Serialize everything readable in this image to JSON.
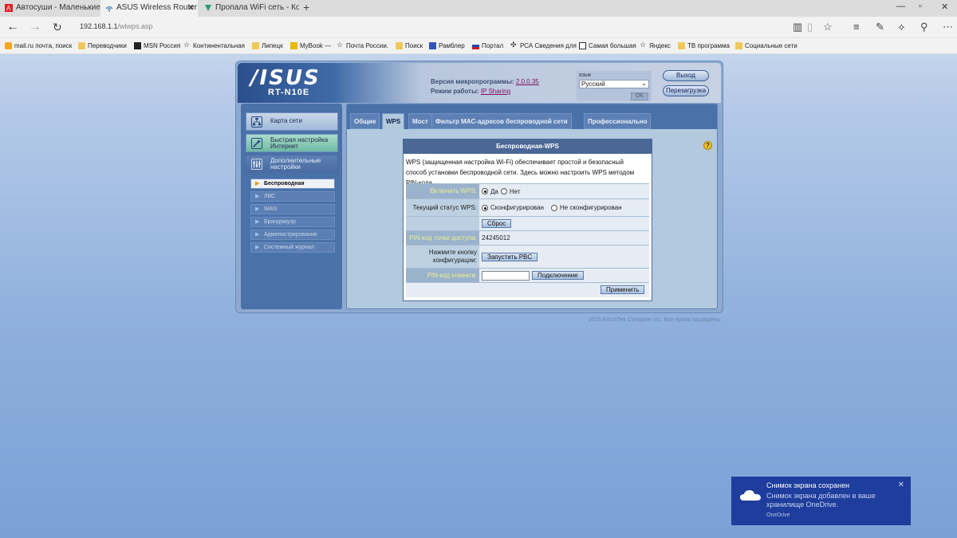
{
  "browser": {
    "tabs": [
      {
        "title": "Автосуши - Маленькие ро",
        "active": false
      },
      {
        "title": "ASUS Wireless Router R",
        "active": true
      },
      {
        "title": "Пропала WiFi сеть - Компь",
        "active": false
      }
    ],
    "url_host": "192.168.1.1",
    "url_path": "/wlwps.asp",
    "favorites": [
      {
        "label": "mail.ru почта, поиск",
        "icon": "mailru-icon"
      },
      {
        "label": "Переводчики",
        "icon": "folder-icon"
      },
      {
        "label": "MSN Россия",
        "icon": "msn-icon"
      },
      {
        "label": "Континентальная",
        "icon": "star-icon"
      },
      {
        "label": "Липецк",
        "icon": "folder-icon"
      },
      {
        "label": "MyBook —",
        "icon": "mybook-icon"
      },
      {
        "label": "Почта России.",
        "icon": "star-icon"
      },
      {
        "label": "Поиск",
        "icon": "folder-icon"
      },
      {
        "label": "Рамблер",
        "icon": "rambler-icon"
      },
      {
        "label": "Портал",
        "icon": "flag-icon"
      },
      {
        "label": "РСА Сведения для",
        "icon": "rsa-icon"
      },
      {
        "label": "Самая большая",
        "icon": "doc-icon"
      },
      {
        "label": "Яндекс",
        "icon": "star-icon"
      },
      {
        "label": "ТВ программа",
        "icon": "folder-icon"
      },
      {
        "label": "Социальные сети",
        "icon": "folder-icon"
      }
    ]
  },
  "router": {
    "logo": "/ISUS",
    "model": "RT-N10E",
    "firmware_label": "Версия микропрограммы:",
    "firmware_value": "2.0.0.35",
    "mode_label": "Режим работы:",
    "mode_value": "IP Sharing",
    "language_label": "язык",
    "language_value": "Русский",
    "ok_label": "OK",
    "logout_label": "Выход",
    "reboot_label": "Перезагрузка",
    "menu": [
      {
        "label": "Карта сети"
      },
      {
        "label": "Быстрая настройка Интернет"
      },
      {
        "label": "Дополнительные настройки"
      }
    ],
    "submenu": [
      {
        "label": "Беспроводная",
        "selected": true
      },
      {
        "label": "ЛВС",
        "selected": false
      },
      {
        "label": "WAN",
        "selected": false
      },
      {
        "label": "Брандмауэр",
        "selected": false
      },
      {
        "label": "Администрирование",
        "selected": false
      },
      {
        "label": "Системный журнал",
        "selected": false
      }
    ],
    "tabs": [
      "Общие",
      "WPS",
      "Мост",
      "Фильтр MAC-адресов беспроводной сети",
      "Профессионально"
    ],
    "panel": {
      "title": "Беспроводная-WPS",
      "description": "WPS (защищенная настройка Wi-Fi) обеспечивает простой и безопасный способ установки беспроводной сети. Здесь можно настроить WPS методом PIN-кода.",
      "enable_label": "Включить WPS:",
      "enable_yes": "Да",
      "enable_no": "Нет",
      "status_label": "Текущий статус WPS:",
      "status_configured": "Сконфигурирован",
      "status_not_configured": "Не сконфигурирован",
      "reset_label": "Сброс",
      "ap_pin_label": "PIN-код точки доступа:",
      "ap_pin_value": "24245012",
      "pbc_label": "Нажмите кнопку конфигурации:",
      "pbc_button": "Запустить PBC",
      "client_pin_label": "PIN-код клиента:",
      "client_pin_value": "",
      "connect_button": "Подключение",
      "apply_button": "Применить"
    },
    "copyright": "2015 ASUSTek Computer Inc. Все права защищены."
  },
  "toast": {
    "title": "Снимок экрана сохранен",
    "body": "Снимок экрана добавлен в ваше хранилище OneDrive.",
    "source": "OneDrive"
  }
}
